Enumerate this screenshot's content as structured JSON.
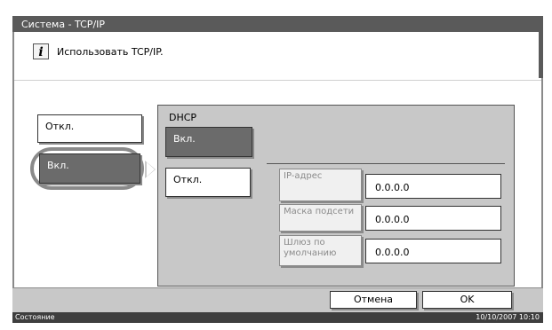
{
  "window": {
    "title": "Система - TCP/IP"
  },
  "info": {
    "icon": "info-icon",
    "glyph": "i",
    "text": "Использовать TCP/IP."
  },
  "tcpip": {
    "off_label": "Откл.",
    "on_label": "Вкл.",
    "selected": "on"
  },
  "dhcp": {
    "label": "DHCP",
    "on_label": "Вкл.",
    "off_label": "Откл.",
    "selected": "on"
  },
  "fields": [
    {
      "label": "IP-адрес",
      "value": "0.0.0.0"
    },
    {
      "label": "Маска подсети",
      "value": "0.0.0.0"
    },
    {
      "label": "Шлюз по умолчанию",
      "value": "0.0.0.0"
    }
  ],
  "actions": {
    "cancel_label": "Отмена",
    "ok_label": "OK"
  },
  "statusbar": {
    "status_label": "Состояние",
    "datetime": "10/10/2007  10:10"
  },
  "colors": {
    "selected_button": "#6b6b6b",
    "panel": "#c8c8c8",
    "titlebar": "#5a5a5a"
  }
}
